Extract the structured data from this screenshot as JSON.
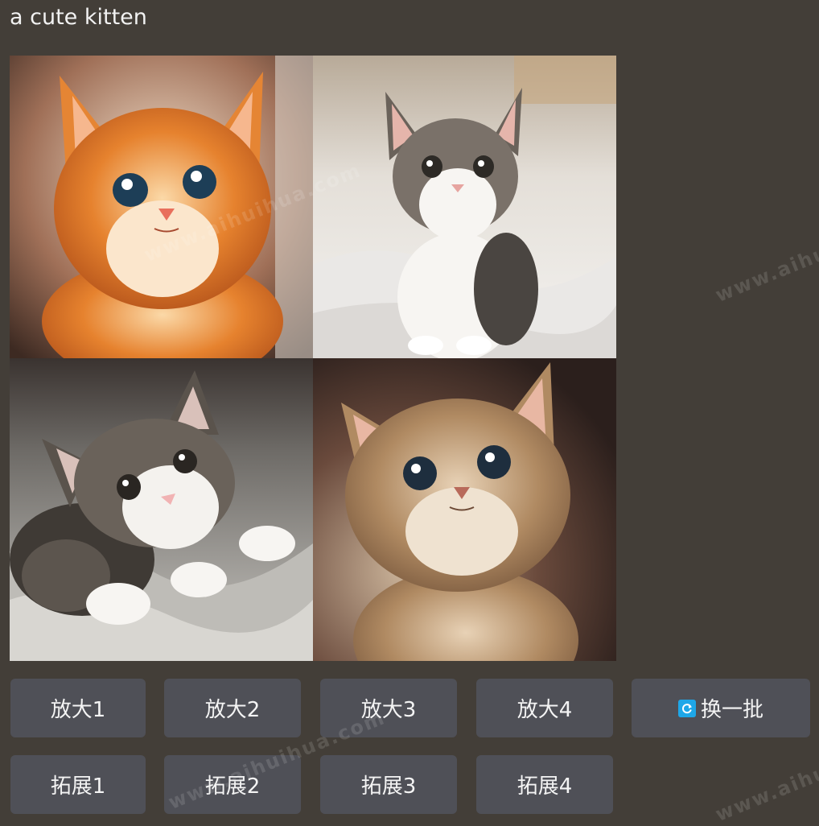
{
  "prompt": "a cute kitten",
  "images": [
    {
      "name": "ginger kitten",
      "accent": "#d8732a"
    },
    {
      "name": "white tabby kitten on bed",
      "accent": "#e9e6e3"
    },
    {
      "name": "tabby kitten lying on blanket",
      "accent": "#8a8a88"
    },
    {
      "name": "brown tabby kitten",
      "accent": "#b08a62"
    }
  ],
  "upscale_buttons": [
    "放大1",
    "放大2",
    "放大3",
    "放大4"
  ],
  "refresh_button": {
    "label": "换一批",
    "icon": "refresh-icon"
  },
  "expand_buttons": [
    "拓展1",
    "拓展2",
    "拓展3",
    "拓展4"
  ],
  "watermark_text": "www.aihuihua.com",
  "colors": {
    "background": "#433e38",
    "button": "#4f5057",
    "button_text": "#f4f4f4",
    "refresh_icon": "#1ea7e8"
  }
}
